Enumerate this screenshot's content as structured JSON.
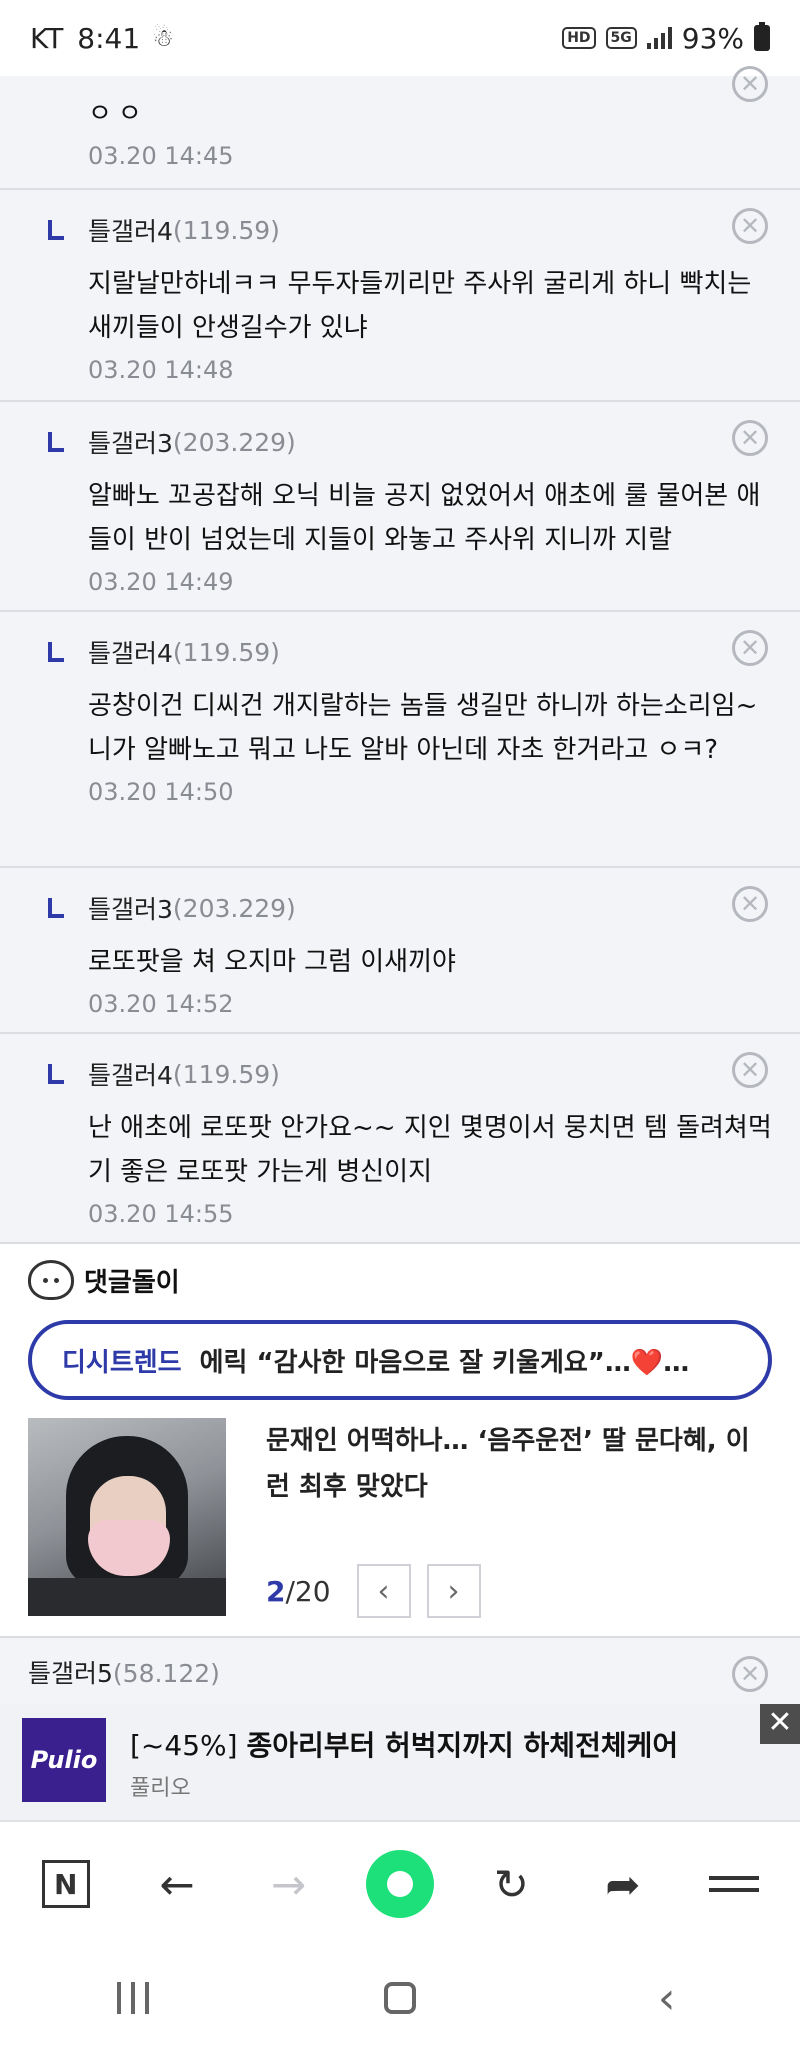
{
  "status_bar": {
    "carrier": "KT",
    "time": "8:41",
    "network": "5G",
    "hd": "HD",
    "battery": "93%"
  },
  "comments": [
    {
      "nick": "",
      "ip": "",
      "text": "ㅇㅇ",
      "date": "03.20 14:45",
      "reply": false
    },
    {
      "nick": "틀갤러4",
      "ip": "(119.59)",
      "text": "지랄날만하네ㅋㅋ 무두자들끼리만 주사위 굴리게 하니 빡치는새끼들이 안생길수가 있냐",
      "date": "03.20 14:48",
      "reply": true
    },
    {
      "nick": "틀갤러3",
      "ip": "(203.229)",
      "text": "알빠노 꼬공잡해 오닉 비늘 공지 없었어서 애초에 룰 물어본 애들이 반이 넘었는데 지들이 와놓고 주사위 지니까 지랄",
      "date": "03.20 14:49",
      "reply": true
    },
    {
      "nick": "틀갤러4",
      "ip": "(119.59)",
      "text": "공창이건 디씨건 개지랄하는 놈들 생길만 하니까 하는소리임~ 니가 알빠노고 뭐고 나도 알바 아닌데 자초 한거라고 ㅇㅋ?",
      "date": "03.20 14:50",
      "reply": true
    },
    {
      "nick": "틀갤러3",
      "ip": "(203.229)",
      "text": "로또팟을 쳐 오지마 그럼 이새끼야",
      "date": "03.20 14:52",
      "reply": true
    },
    {
      "nick": "틀갤러4",
      "ip": "(119.59)",
      "text": "난 애초에 로또팟 안가요~~ 지인 몇명이서 뭉치면 템 돌려쳐먹기 좋은 로또팟 가는게 병신이지",
      "date": "03.20 14:55",
      "reply": true
    }
  ],
  "dolly": {
    "label": "댓글돌이",
    "trend_tag": "디시트렌드",
    "trend_headline": "에릭 “감사한 마음으로 잘 키울게요”…❤️…",
    "news_title": "문재인 어떡하나… ‘음주운전’ 딸 문다혜, 이런 최후 맞았다",
    "page_current": "2",
    "page_total": "/20",
    "prev": "‹",
    "next": "›"
  },
  "next_comment": {
    "nick": "틀갤러5",
    "ip": "(58.122)"
  },
  "ad": {
    "logo": "Pulio",
    "discount": "[~45%]",
    "title": "종아리부터 허벅지까지 하체전체케어",
    "brand": "풀리오",
    "close": "✕"
  },
  "toolbar": {
    "n_label": "N",
    "back": "←",
    "forward": "→",
    "refresh": "↻",
    "share": "➦"
  },
  "colors": {
    "accent": "#2d3aa8",
    "comment_bg": "#f3f4f7",
    "green": "#1ee07a",
    "ad_logo_bg": "#3a1f8f"
  }
}
